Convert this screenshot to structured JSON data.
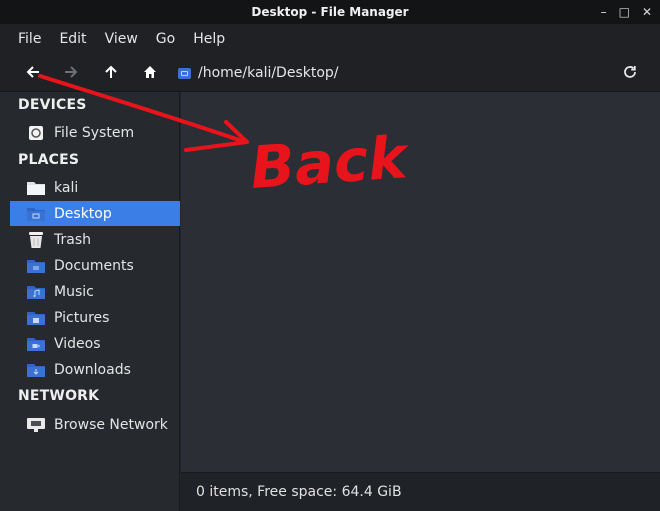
{
  "window": {
    "title": "Desktop - File Manager",
    "minimize_glyph": "–",
    "maximize_glyph": "□",
    "close_glyph": "✕"
  },
  "menu": {
    "items": [
      "File",
      "Edit",
      "View",
      "Go",
      "Help"
    ]
  },
  "toolbar": {
    "back_icon": "arrow-left-icon",
    "forward_icon": "arrow-right-icon",
    "up_icon": "arrow-up-icon",
    "home_icon": "home-icon",
    "path": "/home/kali/Desktop/",
    "refresh_icon": "refresh-icon"
  },
  "sidebar": {
    "devices_heading": "DEVICES",
    "devices": [
      {
        "label": "File System",
        "icon": "drive-icon"
      }
    ],
    "places_heading": "PLACES",
    "places": [
      {
        "label": "kali",
        "icon": "home-folder-icon"
      },
      {
        "label": "Desktop",
        "icon": "desktop-folder-icon"
      },
      {
        "label": "Trash",
        "icon": "trash-icon"
      },
      {
        "label": "Documents",
        "icon": "documents-folder-icon"
      },
      {
        "label": "Music",
        "icon": "music-folder-icon"
      },
      {
        "label": "Pictures",
        "icon": "pictures-folder-icon"
      },
      {
        "label": "Videos",
        "icon": "videos-folder-icon"
      },
      {
        "label": "Downloads",
        "icon": "downloads-folder-icon"
      }
    ],
    "network_heading": "NETWORK",
    "network": [
      {
        "label": "Browse Network",
        "icon": "network-icon"
      }
    ]
  },
  "status": {
    "text": "0 items, Free space: 64.4 GiB"
  },
  "annotation": {
    "text": "Back",
    "color": "#e8141c"
  },
  "colors": {
    "accent": "#3b7fe6",
    "folder": "#3a72d4"
  }
}
